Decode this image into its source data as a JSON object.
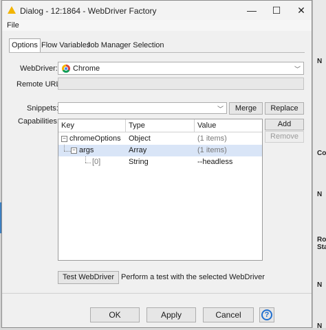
{
  "window": {
    "title": "Dialog - 12:1864 - WebDriver Factory",
    "minimize": "—",
    "maximize": "☐",
    "close": "✕"
  },
  "menu": {
    "file": "File"
  },
  "tabs": [
    "Options",
    "Flow Variables",
    "Job Manager Selection"
  ],
  "options": {
    "webdriver_label": "WebDriver:",
    "webdriver_value": "Chrome",
    "remote_url_label": "Remote URL:",
    "remote_url_value": "",
    "snippets_label": "Snippets:",
    "snippets_value": "",
    "merge": "Merge",
    "replace": "Replace",
    "capabilities_label": "Capabilities:",
    "add": "Add",
    "remove": "Remove",
    "columns": [
      "Key",
      "Type",
      "Value"
    ],
    "rows": [
      {
        "key": "chromeOptions",
        "type": "Object",
        "value": "(1 items)"
      },
      {
        "key": "args",
        "type": "Array",
        "value": "(1 items)"
      },
      {
        "key": "[0]",
        "type": "String",
        "value": "--headless"
      }
    ],
    "test_button": "Test WebDriver",
    "test_description": "Perform a test with the selected WebDriver"
  },
  "footer": {
    "ok": "OK",
    "apply": "Apply",
    "cancel": "Cancel",
    "help": "?"
  },
  "background": {
    "r1": "N",
    "r2": "Co",
    "r3": "N",
    "r4": "Ro",
    "r5": "Sta",
    "r6": "N",
    "r7": "N"
  }
}
